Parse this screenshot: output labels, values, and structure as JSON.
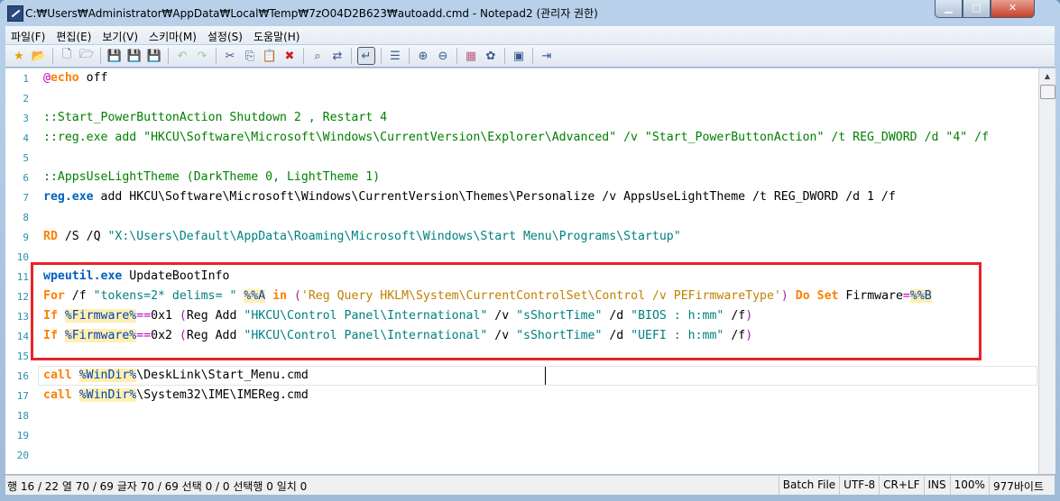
{
  "window": {
    "title": "C:₩Users₩Administrator₩AppData₩Local₩Temp₩7zO04D2B623₩autoadd.cmd - Notepad2 (관리자 권한)"
  },
  "menu": [
    "파일(F)",
    "편집(E)",
    "보기(V)",
    "스키마(M)",
    "설정(S)",
    "도움말(H)"
  ],
  "toolbar": [
    "new-icon",
    "open-icon",
    "|",
    "new-file-icon",
    "open-folder-icon",
    "|",
    "save-icon",
    "save-as-icon",
    "save-copy-icon",
    "|",
    "undo-icon",
    "redo-icon",
    "|",
    "cut-icon",
    "copy-icon",
    "paste-icon",
    "delete-icon",
    "|",
    "find-icon",
    "replace-icon",
    "|",
    "word-wrap-icon",
    "|",
    "list-icon",
    "|",
    "zoom-in-icon",
    "zoom-out-icon",
    "|",
    "scheme-icon",
    "color-icon",
    "|",
    "console-icon",
    "|",
    "exit-icon"
  ],
  "editor": {
    "line_numbers": [
      "1",
      "2",
      "3",
      "4",
      "5",
      "6",
      "7",
      "8",
      "9",
      "10",
      "11",
      "12",
      "13",
      "14",
      "15",
      "16",
      "17",
      "18",
      "19",
      "20"
    ],
    "current_line": 16,
    "lines": [
      [
        [
          "at",
          "@"
        ],
        [
          "kw",
          "echo"
        ],
        [
          "txt",
          " off"
        ]
      ],
      [],
      [
        [
          "com",
          "::Start_PowerButtonAction Shutdown 2 , Restart 4"
        ]
      ],
      [
        [
          "com",
          "::reg.exe add \"HKCU\\Software\\Microsoft\\Windows\\CurrentVersion\\Explorer\\Advanced\" /v \"Start_PowerButtonAction\" /t REG_DWORD /d \"4\" /f"
        ]
      ],
      [],
      [
        [
          "com",
          "::AppsUseLightTheme (DarkTheme 0, LightTheme 1)"
        ]
      ],
      [
        [
          "cmd",
          "reg.exe"
        ],
        [
          "txt",
          " add HKCU\\Software\\Microsoft\\Windows\\CurrentVersion\\Themes\\Personalize /v AppsUseLightTheme /t REG_DWORD /d 1 /f"
        ]
      ],
      [],
      [
        [
          "kw",
          "RD"
        ],
        [
          "txt",
          " /S /Q "
        ],
        [
          "str",
          "\"X:\\Users\\Default\\AppData\\Roaming\\Microsoft\\Windows\\Start Menu\\Programs\\Startup\""
        ]
      ],
      [],
      [
        [
          "cmd",
          "wpeutil.exe"
        ],
        [
          "txt",
          " UpdateBootInfo"
        ]
      ],
      [
        [
          "kw",
          "For"
        ],
        [
          "txt",
          " /f "
        ],
        [
          "str",
          "\"tokens=2* delims= \""
        ],
        [
          "txt",
          " "
        ],
        [
          "var",
          "%%A"
        ],
        [
          "txt",
          " "
        ],
        [
          "kw",
          "in"
        ],
        [
          "txt",
          " "
        ],
        [
          "par",
          "("
        ],
        [
          "bq",
          "'Reg Query HKLM\\System\\CurrentControlSet\\Control /v PEFirmwareType'"
        ],
        [
          "par",
          ")"
        ],
        [
          "txt",
          " "
        ],
        [
          "kw",
          "Do"
        ],
        [
          "txt",
          " "
        ],
        [
          "kw",
          "Set"
        ],
        [
          "txt",
          " Firmware"
        ],
        [
          "op",
          "="
        ],
        [
          "var",
          "%%B"
        ]
      ],
      [
        [
          "kw",
          "If"
        ],
        [
          "txt",
          " "
        ],
        [
          "var",
          "%Firmware%"
        ],
        [
          "op",
          "=="
        ],
        [
          "txt",
          "0x1 "
        ],
        [
          "par",
          "("
        ],
        [
          "txt",
          "Reg Add "
        ],
        [
          "str",
          "\"HKCU\\Control Panel\\International\""
        ],
        [
          "txt",
          " /v "
        ],
        [
          "str",
          "\"sShortTime\""
        ],
        [
          "txt",
          " /d "
        ],
        [
          "str",
          "\"BIOS : h:mm\""
        ],
        [
          "txt",
          " /f"
        ],
        [
          "par",
          ")"
        ]
      ],
      [
        [
          "kw",
          "If"
        ],
        [
          "txt",
          " "
        ],
        [
          "var",
          "%Firmware%"
        ],
        [
          "op",
          "=="
        ],
        [
          "txt",
          "0x2 "
        ],
        [
          "par",
          "("
        ],
        [
          "txt",
          "Reg Add "
        ],
        [
          "str",
          "\"HKCU\\Control Panel\\International\""
        ],
        [
          "txt",
          " /v "
        ],
        [
          "str",
          "\"sShortTime\""
        ],
        [
          "txt",
          " /d "
        ],
        [
          "str",
          "\"UEFI : h:mm\""
        ],
        [
          "txt",
          " /f"
        ],
        [
          "par",
          ")"
        ]
      ],
      [],
      [
        [
          "kw",
          "call"
        ],
        [
          "txt",
          " "
        ],
        [
          "var",
          "%WinDir%"
        ],
        [
          "txt",
          "\\DeskLink\\Start_Menu.cmd"
        ]
      ],
      [
        [
          "kw",
          "call"
        ],
        [
          "txt",
          " "
        ],
        [
          "var",
          "%WinDir%"
        ],
        [
          "txt",
          "\\System32\\IME\\IMEReg.cmd"
        ]
      ],
      [],
      [],
      []
    ]
  },
  "highlight_color": "#e8232a",
  "status": {
    "position": "행 16 / 22  열 70 / 69  글자 70 / 69  선택 0 / 0  선택행 0  일치 0",
    "scheme": "Batch File",
    "encoding": "UTF-8",
    "line_ending": "CR+LF",
    "mode": "INS",
    "zoom": "100%",
    "size": "977바이트"
  }
}
